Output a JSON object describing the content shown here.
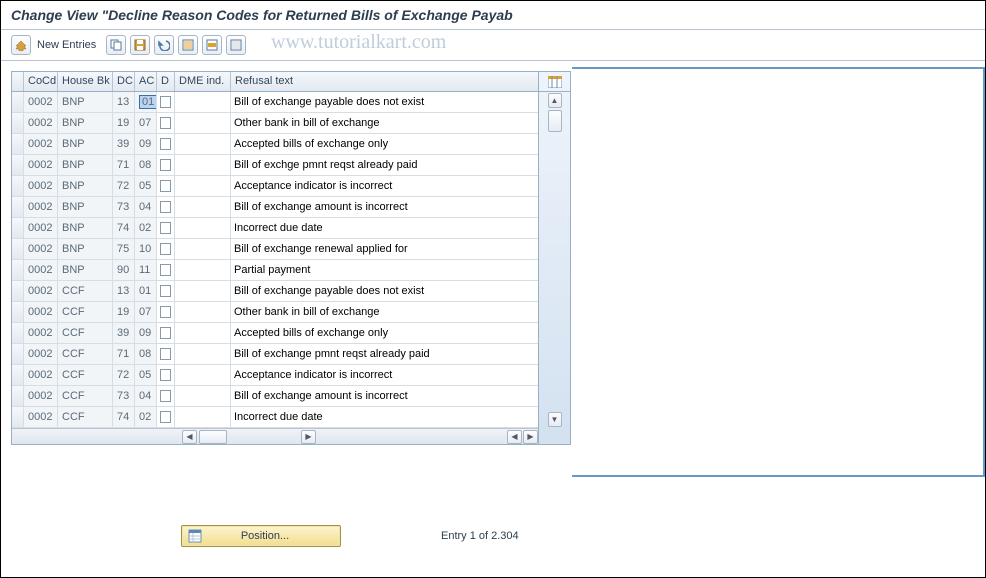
{
  "title": "Change View \"Decline Reason Codes for Returned Bills of Exchange Payab",
  "watermark": "www.tutorialkart.com",
  "toolbar": {
    "new_entries": "New Entries"
  },
  "columns": {
    "cocd": "CoCd",
    "housebk": "House Bk",
    "dc": "DC",
    "ac": "AC",
    "d": "D",
    "dme": "DME ind.",
    "refusal": "Refusal text"
  },
  "rows": [
    {
      "cocd": "0002",
      "hb": "BNP",
      "dc": "13",
      "ac": "01",
      "rt": "Bill of exchange payable does not exist",
      "sel": true
    },
    {
      "cocd": "0002",
      "hb": "BNP",
      "dc": "19",
      "ac": "07",
      "rt": "Other bank in bill of exchange"
    },
    {
      "cocd": "0002",
      "hb": "BNP",
      "dc": "39",
      "ac": "09",
      "rt": "Accepted bills of exchange only"
    },
    {
      "cocd": "0002",
      "hb": "BNP",
      "dc": "71",
      "ac": "08",
      "rt": "Bill of exchge pmnt reqst already paid"
    },
    {
      "cocd": "0002",
      "hb": "BNP",
      "dc": "72",
      "ac": "05",
      "rt": "Acceptance indicator is incorrect"
    },
    {
      "cocd": "0002",
      "hb": "BNP",
      "dc": "73",
      "ac": "04",
      "rt": "Bill of exchange amount is incorrect"
    },
    {
      "cocd": "0002",
      "hb": "BNP",
      "dc": "74",
      "ac": "02",
      "rt": "Incorrect due date"
    },
    {
      "cocd": "0002",
      "hb": "BNP",
      "dc": "75",
      "ac": "10",
      "rt": "Bill of exchange renewal applied for"
    },
    {
      "cocd": "0002",
      "hb": "BNP",
      "dc": "90",
      "ac": "11",
      "rt": "Partial payment"
    },
    {
      "cocd": "0002",
      "hb": "CCF",
      "dc": "13",
      "ac": "01",
      "rt": "Bill of exchange payable does not exist"
    },
    {
      "cocd": "0002",
      "hb": "CCF",
      "dc": "19",
      "ac": "07",
      "rt": "Other bank in bill of exchange"
    },
    {
      "cocd": "0002",
      "hb": "CCF",
      "dc": "39",
      "ac": "09",
      "rt": "Accepted bills of exchange only"
    },
    {
      "cocd": "0002",
      "hb": "CCF",
      "dc": "71",
      "ac": "08",
      "rt": "Bill of exchange pmnt reqst already paid"
    },
    {
      "cocd": "0002",
      "hb": "CCF",
      "dc": "72",
      "ac": "05",
      "rt": "Acceptance indicator is incorrect"
    },
    {
      "cocd": "0002",
      "hb": "CCF",
      "dc": "73",
      "ac": "04",
      "rt": "Bill of exchange amount is incorrect"
    },
    {
      "cocd": "0002",
      "hb": "CCF",
      "dc": "74",
      "ac": "02",
      "rt": "Incorrect due date"
    }
  ],
  "footer": {
    "position": "Position...",
    "entry": "Entry 1 of 2.304"
  }
}
